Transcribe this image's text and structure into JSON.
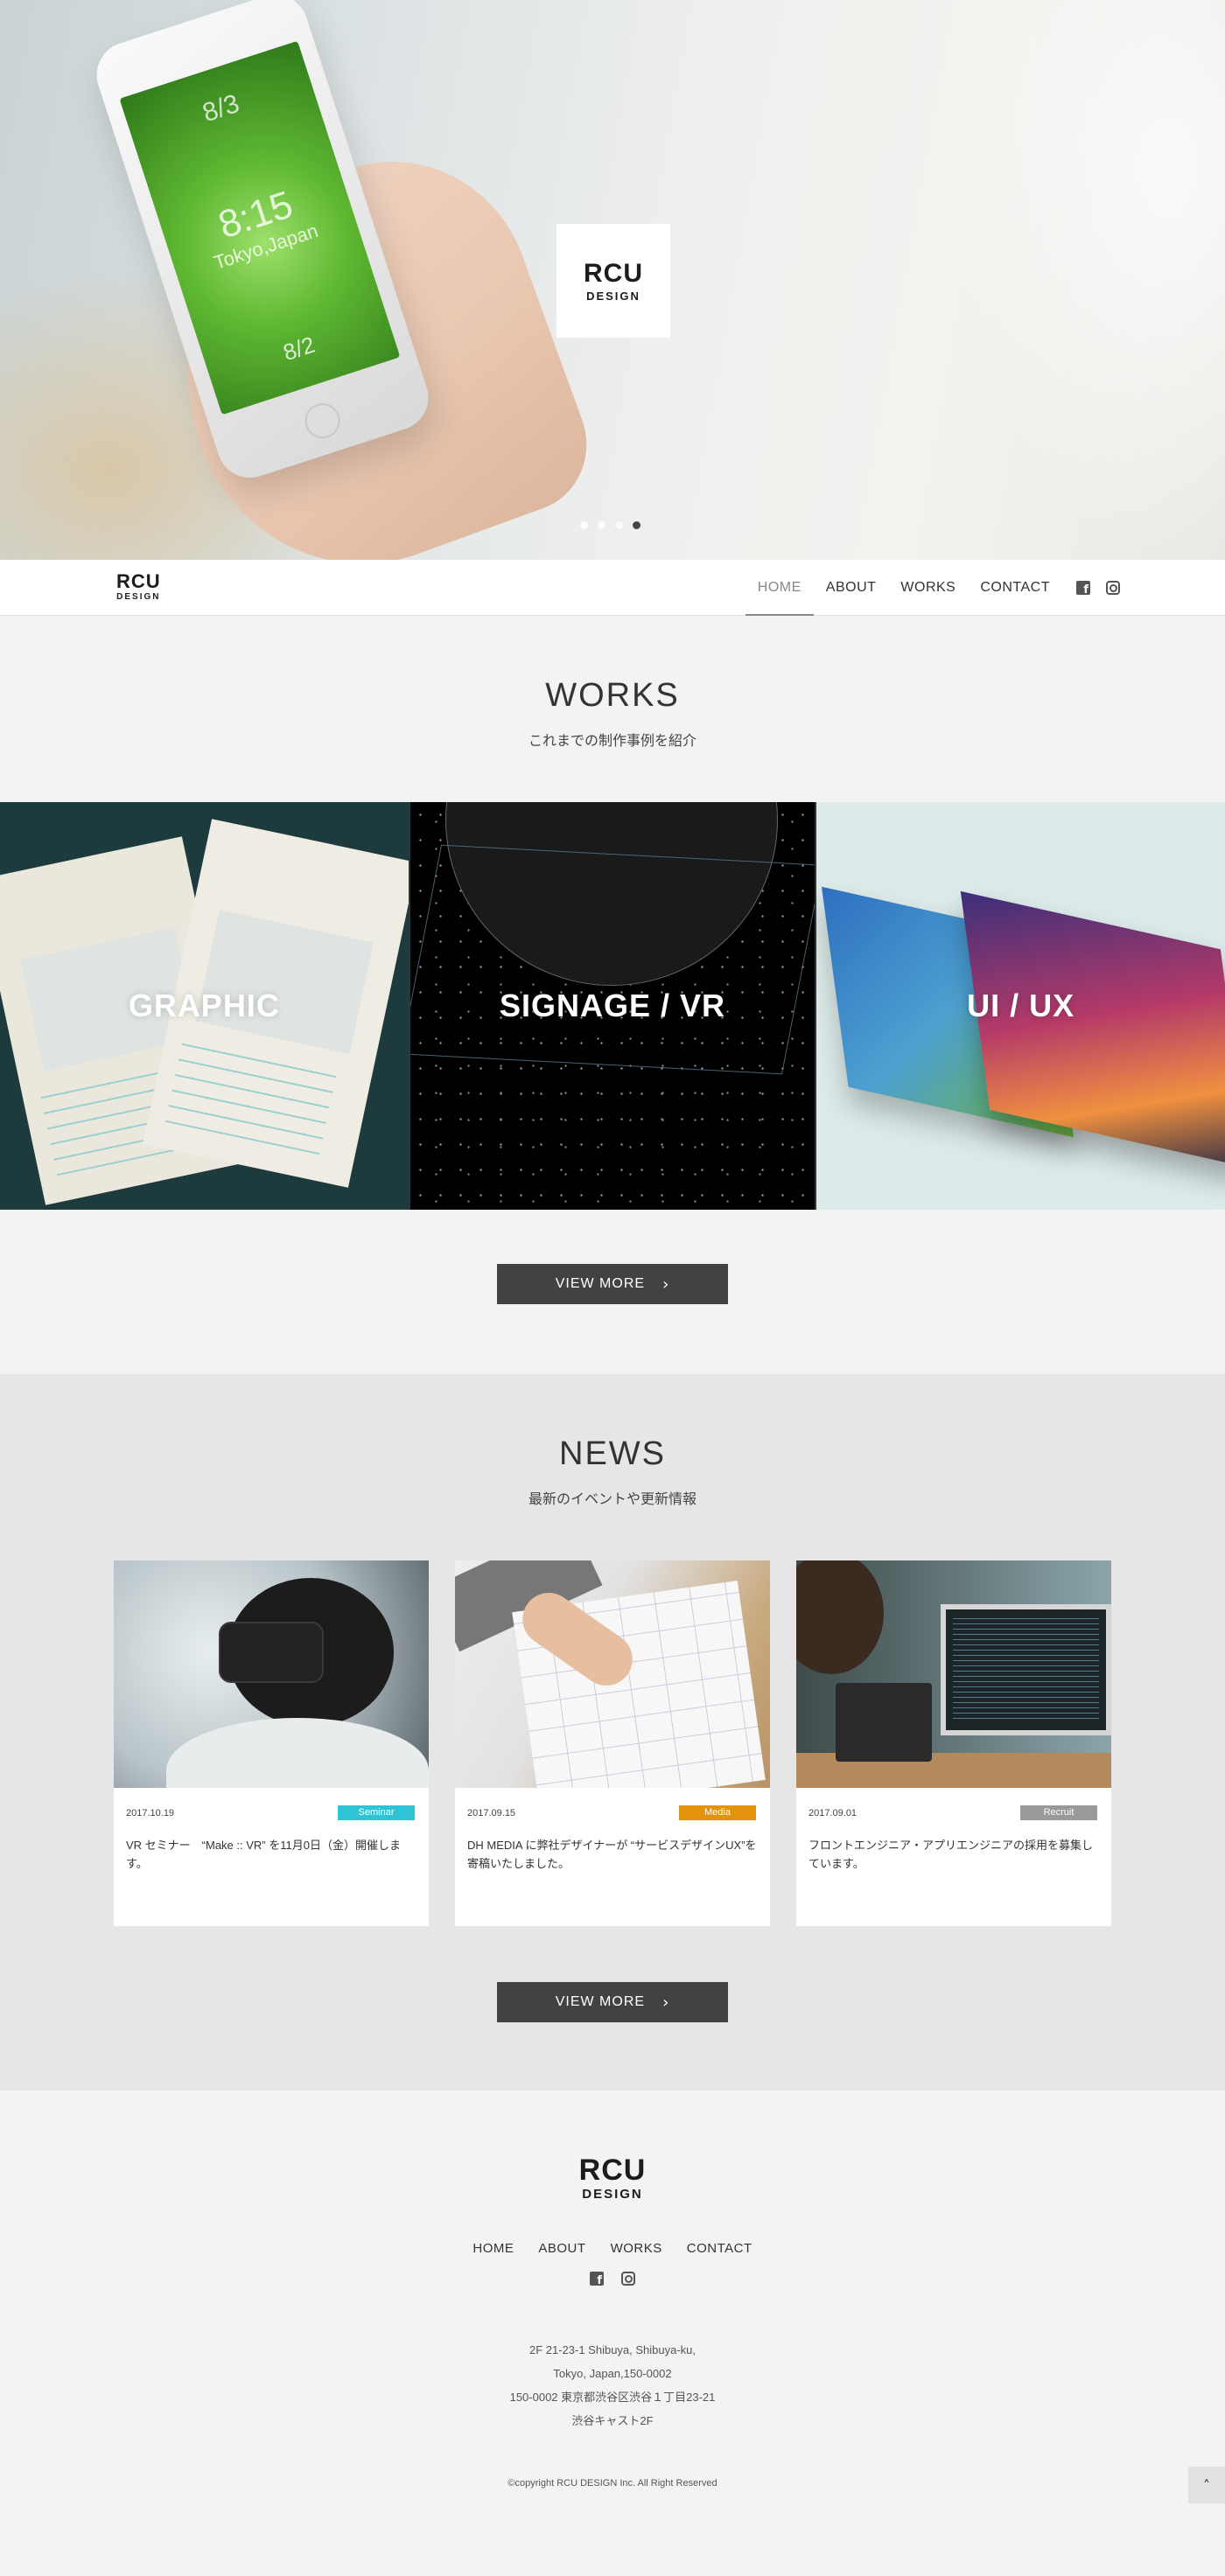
{
  "hero": {
    "logo_main": "RCU",
    "logo_sub": "DESIGN",
    "phone_screen": {
      "top_date": "8/3",
      "time": "8:15",
      "city": "Tokyo,Japan",
      "bottom_date": "8/2"
    },
    "slide_count": 4,
    "active_slide": 4
  },
  "nav": {
    "logo_main": "RCU",
    "logo_sub": "DESIGN",
    "items": [
      {
        "label": "HOME",
        "active": true
      },
      {
        "label": "ABOUT",
        "active": false
      },
      {
        "label": "WORKS",
        "active": false
      },
      {
        "label": "CONTACT",
        "active": false
      }
    ],
    "social_icons": [
      "facebook-icon",
      "instagram-icon"
    ]
  },
  "works": {
    "title": "WORKS",
    "subtitle": "これまでの制作事例を紹介",
    "tiles": [
      {
        "label": "GRAPHIC"
      },
      {
        "label": "SIGNAGE / VR"
      },
      {
        "label": "UI / UX"
      }
    ],
    "button_label": "VIEW MORE"
  },
  "news": {
    "title": "NEWS",
    "subtitle": "最新のイベントや更新情報",
    "items": [
      {
        "date": "2017.10.19",
        "category": "Seminar",
        "category_color": "#2ec4d6",
        "text": "VR セミナー　“Make :: VR” を11月0日（金）開催します。"
      },
      {
        "date": "2017.09.15",
        "category": "Media",
        "category_color": "#e2920c",
        "text": "DH MEDIA に弊社デザイナーが “サービスデザインUX”を寄稿いたしました。"
      },
      {
        "date": "2017.09.01",
        "category": "Recruit",
        "category_color": "#999999",
        "text": "フロントエンジニア・アプリエンジニアの採用を募集しています。"
      }
    ],
    "button_label": "VIEW MORE"
  },
  "footer": {
    "logo_main": "RCU",
    "logo_sub": "DESIGN",
    "menu": [
      "HOME",
      "ABOUT",
      "WORKS",
      "CONTACT"
    ],
    "address_lines": [
      "2F 21-23-1 Shibuya, Shibuya-ku,",
      "Tokyo, Japan,150-0002",
      "150-0002 東京都渋谷区渋谷１丁目23-21",
      "渋谷キャスト2F"
    ],
    "copyright": "©copyright RCU DESIGN Inc. All Right Reserved",
    "to_top_icon": "chevron-up-icon"
  },
  "colors": {
    "dark_button": "#424242",
    "news_bg": "#e6e6e6",
    "page_bg": "#f3f3f3"
  }
}
